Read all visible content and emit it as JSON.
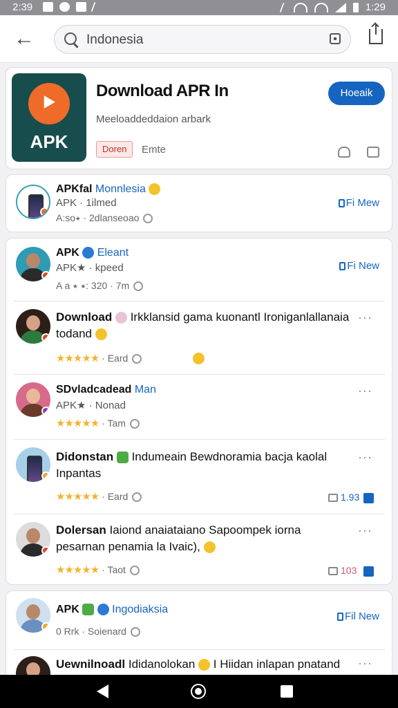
{
  "status_bar": {
    "time": "2:39",
    "right_time": "1:29"
  },
  "search": {
    "value": "Indonesia"
  },
  "app_card": {
    "icon_text": "APK",
    "title": "Download APR In",
    "subtitle": "Meeloaddeddaion arbark",
    "badge": "Doren",
    "extra": "Emte",
    "button": "Hoeaik"
  },
  "rows": [
    {
      "name": "APKfal",
      "name_blue": "Monnlesia",
      "sub": "APK · 1ilmed",
      "meta": "A:so⭑ · 2dlanseoao",
      "link": "Fi Mew"
    },
    {
      "name": "APK",
      "name_blue": "Eleant",
      "sub": "APK★ · kpeed",
      "meta": "A a ⭑ ⭑: 320 · 7m",
      "link": "Fi New"
    }
  ],
  "posts": [
    {
      "title_bold": "Download",
      "title": "Irkklansid gama kuonantl Ironiganlallanaia todand",
      "stars": "★★★★★",
      "meta": "· Eard",
      "count": ""
    },
    {
      "title_bold": "SDvladcadead",
      "title_blue": "Man",
      "sub": "APK★ · Nonad",
      "stars": "★★★★★",
      "meta": "· Tam",
      "count": ""
    },
    {
      "title_bold": "Didonstan",
      "title": "Indumeain Bewdnoramia bacja kaolal Inpantas",
      "stars": "★★★★★",
      "meta": "· Eard",
      "count": "1.93"
    },
    {
      "title_bold": "Dolersan",
      "title": "Iaiond anaiataiano Sapoompek iorna pesarnan penamia la Ivaic),",
      "stars": "★★★★★",
      "meta": "· Taot",
      "count": "103"
    }
  ],
  "bottom_row": {
    "name": "APK",
    "name_blue": "Ingodiaksia",
    "sub": "0 Rrk · Soienard",
    "link": "Fil New"
  },
  "last_post": {
    "title_bold": "Uewnilnoadl",
    "title": "Ididanolokan",
    "title2": "I Hiidan inlapan pnatand"
  }
}
